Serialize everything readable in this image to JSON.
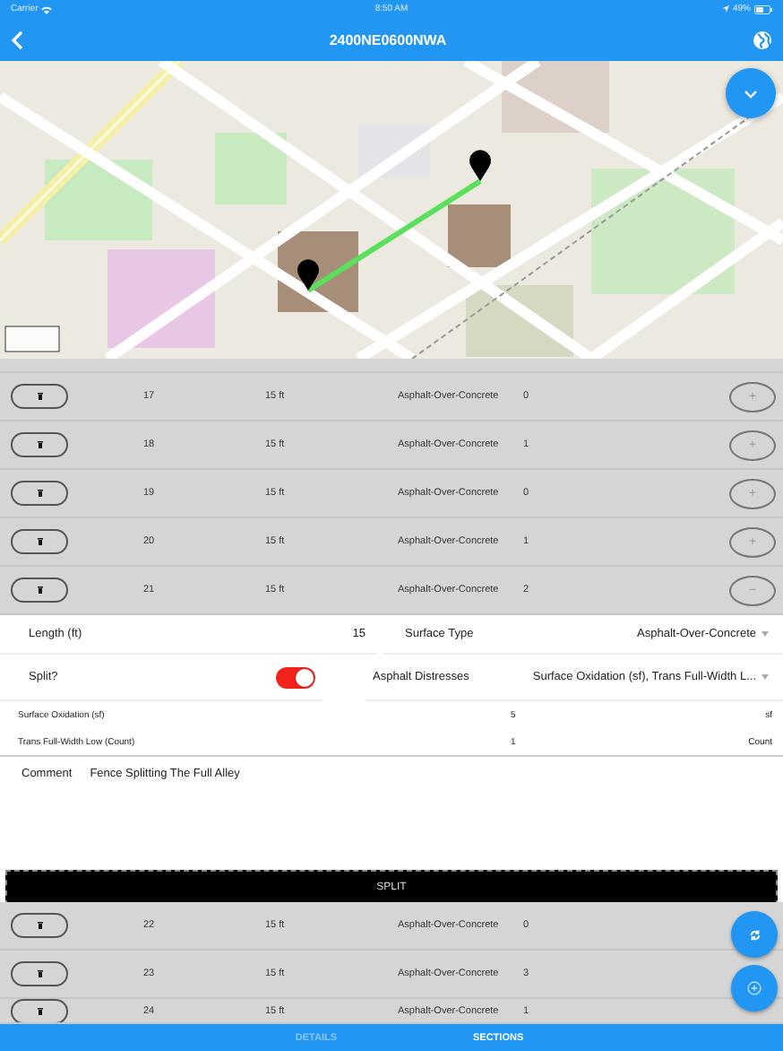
{
  "status_bar": {
    "carrier": "Carrier",
    "time": "8:50 AM",
    "battery": "49%"
  },
  "nav": {
    "title": "2400NE0600NWA"
  },
  "sections_top": [
    {
      "number": "17",
      "length": "15 ft",
      "surface": "Asphalt-Over-Concrete",
      "distresses": "0",
      "action": "+"
    },
    {
      "number": "18",
      "length": "15 ft",
      "surface": "Asphalt-Over-Concrete",
      "distresses": "1",
      "action": "+"
    },
    {
      "number": "19",
      "length": "15 ft",
      "surface": "Asphalt-Over-Concrete",
      "distresses": "0",
      "action": "+"
    },
    {
      "number": "20",
      "length": "15 ft",
      "surface": "Asphalt-Over-Concrete",
      "distresses": "1",
      "action": "+"
    },
    {
      "number": "21",
      "length": "15 ft",
      "surface": "Asphalt-Over-Concrete",
      "distresses": "2",
      "action": "−"
    }
  ],
  "form": {
    "length": {
      "label": "Length (ft)",
      "value": "15"
    },
    "surface_type": {
      "label": "Surface Type",
      "value": "Asphalt-Over-Concrete"
    },
    "split": {
      "label": "Split?",
      "on": true
    },
    "asphalt_distresses": {
      "label": "Asphalt Distresses",
      "value": "Surface Oxidation (sf), Trans Full-Width L..."
    },
    "measurements": [
      {
        "label": "Surface Oxidation (sf)",
        "value": "5",
        "unit": "sf"
      },
      {
        "label": "Trans Full-Width Low (Count)",
        "value": "1",
        "unit": "Count"
      }
    ],
    "comment": {
      "label": "Comment",
      "value": "Fence Splitting The Full Alley"
    }
  },
  "split_button": {
    "label": "SPLIT"
  },
  "sections_bottom": [
    {
      "number": "22",
      "length": "15 ft",
      "surface": "Asphalt-Over-Concrete",
      "distresses": "0"
    },
    {
      "number": "23",
      "length": "15 ft",
      "surface": "Asphalt-Over-Concrete",
      "distresses": "3"
    },
    {
      "number": "24",
      "length": "15 ft",
      "surface": "Asphalt-Over-Concrete",
      "distresses": "1"
    }
  ],
  "tabs": [
    {
      "label": "DETAILS",
      "selected": false
    },
    {
      "label": "SECTIONS",
      "selected": true
    }
  ]
}
